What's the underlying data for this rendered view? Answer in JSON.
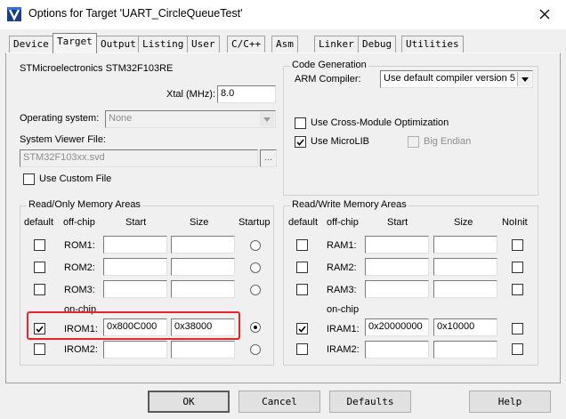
{
  "window": {
    "title": "Options for Target 'UART_CircleQueueTest'"
  },
  "tabs": [
    {
      "label": "Device"
    },
    {
      "label": "Target"
    },
    {
      "label": "Output"
    },
    {
      "label": "Listing"
    },
    {
      "label": "User"
    },
    {
      "label": "C/C++"
    },
    {
      "label": "Asm"
    },
    {
      "label": "Linker"
    },
    {
      "label": "Debug"
    },
    {
      "label": "Utilities"
    }
  ],
  "active_tab": "Target",
  "target": {
    "device_name": "STMicroelectronics STM32F103RE",
    "xtal_label": "Xtal (MHz):",
    "xtal_value": "8.0",
    "os_label": "Operating system:",
    "os_value": "None",
    "svd_label": "System Viewer File:",
    "svd_value": "STM32F103xx.svd",
    "browse_label": "...",
    "custom_file_label": "Use Custom File"
  },
  "codegen": {
    "legend": "Code Generation",
    "compiler_label": "ARM Compiler:",
    "compiler_value": "Use default compiler version 5",
    "cross_module_label": "Use Cross-Module Optimization",
    "microlib_label": "Use MicroLIB",
    "big_endian_label": "Big Endian"
  },
  "rom": {
    "legend": "Read/Only Memory Areas",
    "headers": {
      "default": "default",
      "offchip": "off-chip",
      "start": "Start",
      "size": "Size",
      "startup": "Startup"
    },
    "onchip_label": "on-chip",
    "rows": [
      {
        "name": "ROM1:",
        "start": "",
        "size": "",
        "default": false,
        "startup": false
      },
      {
        "name": "ROM2:",
        "start": "",
        "size": "",
        "default": false,
        "startup": false
      },
      {
        "name": "ROM3:",
        "start": "",
        "size": "",
        "default": false,
        "startup": false
      },
      {
        "name": "IROM1:",
        "start": "0x800C000",
        "size": "0x38000",
        "default": true,
        "startup": true
      },
      {
        "name": "IROM2:",
        "start": "",
        "size": "",
        "default": false,
        "startup": false
      }
    ]
  },
  "ram": {
    "legend": "Read/Write Memory Areas",
    "headers": {
      "default": "default",
      "offchip": "off-chip",
      "start": "Start",
      "size": "Size",
      "noinit": "NoInit"
    },
    "onchip_label": "on-chip",
    "rows": [
      {
        "name": "RAM1:",
        "start": "",
        "size": "",
        "default": false
      },
      {
        "name": "RAM2:",
        "start": "",
        "size": "",
        "default": false
      },
      {
        "name": "RAM3:",
        "start": "",
        "size": "",
        "default": false
      },
      {
        "name": "IRAM1:",
        "start": "0x20000000",
        "size": "0x10000",
        "default": true
      },
      {
        "name": "IRAM2:",
        "start": "",
        "size": "",
        "default": false
      }
    ]
  },
  "buttons": {
    "ok": "OK",
    "cancel": "Cancel",
    "defaults": "Defaults",
    "help": "Help"
  },
  "colors": {
    "highlight": "#e8262a",
    "dialog_bg": "#f0f0f0"
  }
}
